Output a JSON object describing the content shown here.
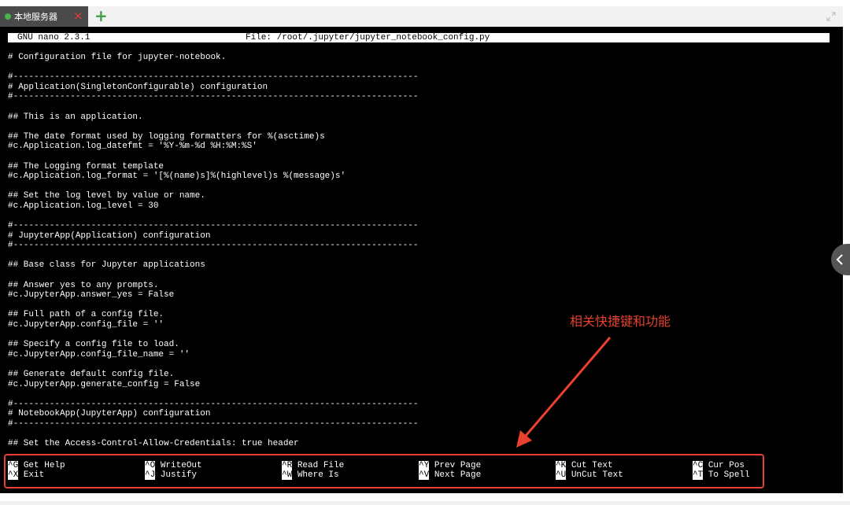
{
  "tab": {
    "title": "本地服务器",
    "close_icon": "×",
    "add_icon": "+"
  },
  "terminal": {
    "status_left": "GNU nano 2.3.1",
    "status_file": "File: /root/.jupyter/jupyter_notebook_config.py",
    "lines": [
      "# Configuration file for jupyter-notebook.",
      "",
      "#------------------------------------------------------------------------------",
      "# Application(SingletonConfigurable) configuration",
      "#------------------------------------------------------------------------------",
      "",
      "## This is an application.",
      "",
      "## The date format used by logging formatters for %(asctime)s",
      "#c.Application.log_datefmt = '%Y-%m-%d %H:%M:%S'",
      "",
      "## The Logging format template",
      "#c.Application.log_format = '[%(name)s]%(highlevel)s %(message)s'",
      "",
      "## Set the log level by value or name.",
      "#c.Application.log_level = 30",
      "",
      "#------------------------------------------------------------------------------",
      "# JupyterApp(Application) configuration",
      "#------------------------------------------------------------------------------",
      "",
      "## Base class for Jupyter applications",
      "",
      "## Answer yes to any prompts.",
      "#c.JupyterApp.answer_yes = False",
      "",
      "## Full path of a config file.",
      "#c.JupyterApp.config_file = ''",
      "",
      "## Specify a config file to load.",
      "#c.JupyterApp.config_file_name = ''",
      "",
      "## Generate default config file.",
      "#c.JupyterApp.generate_config = False",
      "",
      "#------------------------------------------------------------------------------",
      "# NotebookApp(JupyterApp) configuration",
      "#------------------------------------------------------------------------------",
      "",
      "## Set the Access-Control-Allow-Credentials: true header"
    ]
  },
  "shortcuts": [
    {
      "key": "^G",
      "label": "Get Help"
    },
    {
      "key": "^O",
      "label": "WriteOut"
    },
    {
      "key": "^R",
      "label": "Read File"
    },
    {
      "key": "^Y",
      "label": "Prev Page"
    },
    {
      "key": "^K",
      "label": "Cut Text"
    },
    {
      "key": "^C",
      "label": "Cur Pos"
    },
    {
      "key": "^X",
      "label": "Exit"
    },
    {
      "key": "^J",
      "label": "Justify"
    },
    {
      "key": "^W",
      "label": "Where Is"
    },
    {
      "key": "^V",
      "label": "Next Page"
    },
    {
      "key": "^U",
      "label": "UnCut Text"
    },
    {
      "key": "^T",
      "label": "To Spell"
    }
  ],
  "annotation": {
    "text": "相关快捷键和功能",
    "color": "#e8412d"
  },
  "icons": {
    "expand": "expand-icon",
    "side": "chevron-left-icon",
    "status_dot": "green-dot-icon"
  },
  "colors": {
    "accent_red": "#e8412d",
    "status_green": "#4caf50",
    "add_green": "#3fa143"
  }
}
